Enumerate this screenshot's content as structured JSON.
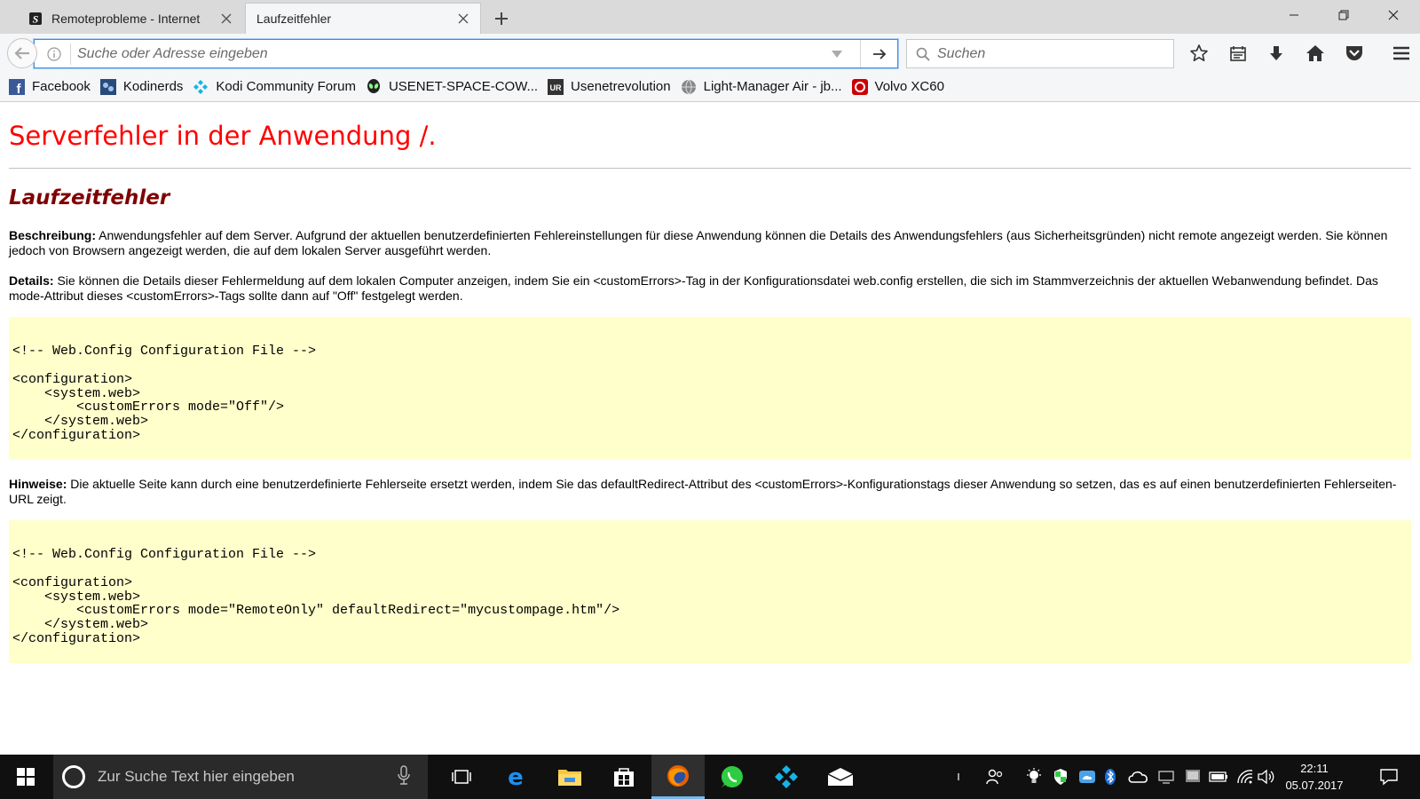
{
  "browser": {
    "tabs": [
      {
        "title": "Remoteprobleme - Internet",
        "active": false
      },
      {
        "title": "Laufzeitfehler",
        "active": true
      }
    ],
    "urlbar": {
      "placeholder": "Suche oder Adresse eingeben",
      "value": ""
    },
    "searchbar": {
      "placeholder": "Suchen"
    },
    "bookmarks": [
      {
        "label": "Facebook",
        "icon": "facebook-icon",
        "color": "#3b5998"
      },
      {
        "label": "Kodinerds",
        "icon": "kodinerds-icon",
        "color": "#2a4a7a"
      },
      {
        "label": "Kodi Community Forum",
        "icon": "kodi-icon",
        "color": "#17b2e7"
      },
      {
        "label": "USENET-SPACE-COW...",
        "icon": "alien-icon",
        "color": "#222222"
      },
      {
        "label": "Usenetrevolution",
        "icon": "usenetrevolution-icon",
        "color": "#333333"
      },
      {
        "label": "Light-Manager Air - jb...",
        "icon": "globe-icon",
        "color": "#888888"
      },
      {
        "label": "Volvo XC60",
        "icon": "volvo-icon",
        "color": "#cc0000"
      }
    ]
  },
  "page": {
    "heading": "Serverfehler in der Anwendung /.",
    "subheading": "Laufzeitfehler",
    "description_label": "Beschreibung:",
    "description_text": "Anwendungsfehler auf dem Server. Aufgrund der aktuellen benutzerdefinierten Fehlereinstellungen für diese Anwendung können die Details des Anwendungsfehlers (aus Sicherheitsgründen) nicht remote angezeigt werden. Sie können jedoch von Browsern angezeigt werden, die auf dem lokalen Server ausgeführt werden.",
    "details_label": "Details:",
    "details_text": "Sie können die Details dieser Fehlermeldung auf dem lokalen Computer anzeigen, indem Sie ein <customErrors>-Tag in der Konfigurationsdatei web.config erstellen, die sich im Stammverzeichnis der aktuellen Webanwendung befindet. Das mode-Attribut dieses <customErrors>-Tags sollte dann auf \"Off\" festgelegt werden.",
    "code1": "\n\n<!-- Web.Config Configuration File -->\n\n<configuration>\n    <system.web>\n        <customErrors mode=\"Off\"/>\n    </system.web>\n</configuration>\n\n",
    "notes_label": "Hinweise:",
    "notes_text": "Die aktuelle Seite kann durch eine benutzerdefinierte Fehlerseite ersetzt werden, indem Sie das defaultRedirect-Attribut des <customErrors>-Konfigurationstags dieser Anwendung so setzen, das es auf einen benutzerdefinierten Fehlerseiten-URL zeigt.",
    "code2": "\n\n<!-- Web.Config Configuration File -->\n\n<configuration>\n    <system.web>\n        <customErrors mode=\"RemoteOnly\" defaultRedirect=\"mycustompage.htm\"/>\n    </system.web>\n</configuration>\n\n"
  },
  "taskbar": {
    "search_placeholder": "Zur Suche Text hier eingeben",
    "time": "22:11",
    "date": "05.07.2017"
  },
  "colors": {
    "heading": "#ff0000",
    "subheading": "#800000",
    "code_bg": "#ffffcc",
    "urlbar_focus": "#3a8ee6",
    "taskbar_bg": "#101010"
  }
}
